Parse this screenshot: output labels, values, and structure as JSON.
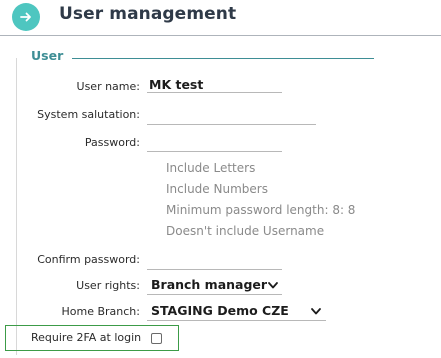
{
  "header": {
    "title": "User management",
    "back_icon": "arrow-right-icon"
  },
  "colors": {
    "accent": "#4ec6c0",
    "section": "#3e8e95",
    "highlight_border": "#3c9b47"
  },
  "section": {
    "title": "User"
  },
  "form": {
    "username": {
      "label": "User name:",
      "value": "MK test"
    },
    "salutation": {
      "label": "System salutation:",
      "value": ""
    },
    "password": {
      "label": "Password:",
      "value": "",
      "hints": [
        "Include Letters",
        "Include Numbers",
        "Minimum password length: 8: 8",
        "Doesn't include Username"
      ]
    },
    "confirm_password": {
      "label": "Confirm password:",
      "value": ""
    },
    "user_rights": {
      "label": "User rights:",
      "value": "Branch manager"
    },
    "home_branch": {
      "label": "Home Branch:",
      "value": "STAGING Demo CZE"
    },
    "require_2fa": {
      "label": "Require 2FA at login",
      "checked": false
    }
  }
}
